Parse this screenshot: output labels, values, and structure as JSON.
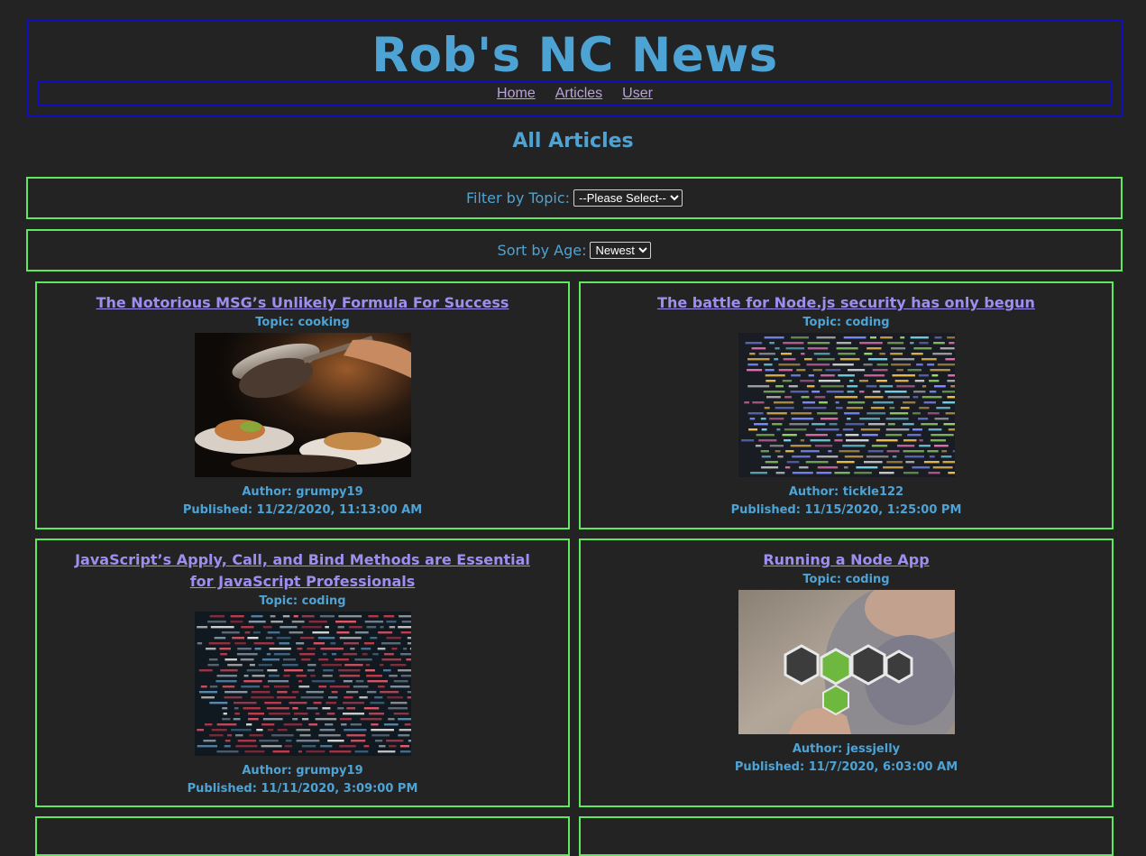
{
  "header": {
    "title": "Rob's NC News",
    "nav": [
      "Home",
      "Articles",
      "User"
    ]
  },
  "page_heading": "All Articles",
  "filter": {
    "label": "Filter by Topic:",
    "selected": "--Please Select--"
  },
  "sort": {
    "label": "Sort by Age:",
    "selected": "Newest"
  },
  "articles": [
    {
      "title": "The Notorious MSG’s Unlikely Formula For Success",
      "topic": "Topic: cooking",
      "author": "Author: grumpy19",
      "published": "Published: 11/22/2020, 11:13:00 AM"
    },
    {
      "title": "The battle for Node.js security has only begun",
      "topic": "Topic: coding",
      "author": "Author: tickle122",
      "published": "Published: 11/15/2020, 1:25:00 PM"
    },
    {
      "title": "JavaScript’s Apply, Call, and Bind Methods are Essential for JavaScript Professionals",
      "topic": "Topic: coding",
      "author": "Author: grumpy19",
      "published": "Published: 11/11/2020, 3:09:00 PM"
    },
    {
      "title": "Running a Node App",
      "topic": "Topic: coding",
      "author": "Author: jessjelly",
      "published": "Published: 11/7/2020, 6:03:00 AM"
    }
  ],
  "images": {
    "article_0": "cooking-pan-photo",
    "article_1": "code-screen-photo",
    "article_2": "code-screen-dark-photo",
    "article_3": "node-js-sticker-photo"
  },
  "colors": {
    "background": "#232323",
    "header_border": "#0f0fbf",
    "card_border": "#5ee85e",
    "accent_text": "#4ea3d5",
    "link_text": "#9d8ff0",
    "nav_link": "#b9a3dc"
  }
}
